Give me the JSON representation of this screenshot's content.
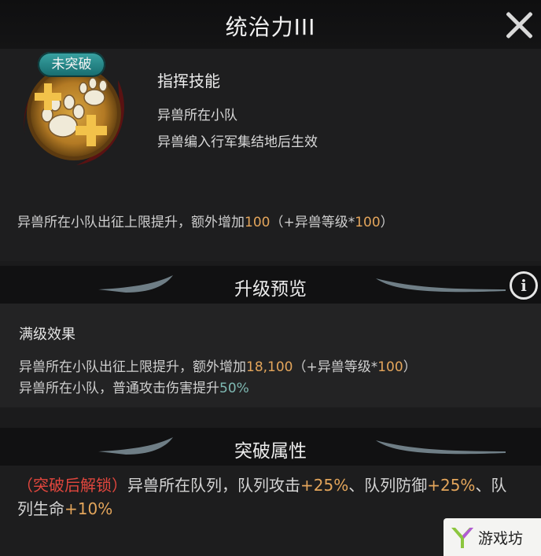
{
  "header": {
    "title": "统治力III"
  },
  "skill": {
    "badge": "未突破",
    "type": "指挥技能",
    "line1": "异兽所在小队",
    "line2": "异兽编入行军集结地后生效"
  },
  "effect": {
    "prefix": "异兽所在小队出征上限提升，额外增加",
    "value": "100",
    "suffix_open": "（+异兽等级*",
    "suffix_value": "100",
    "suffix_close": "）"
  },
  "upgrade": {
    "title": "升级预览",
    "info_label": "i",
    "max_label": "满级效果",
    "line1_prefix": "异兽所在小队出征上限提升，额外增加",
    "line1_value": "18,100",
    "line1_suffix_open": "（+异兽等级*",
    "line1_suffix_value": "100",
    "line1_suffix_close": "）",
    "line2_prefix": "异兽所在小队，普通攻击伤害提升",
    "line2_value": "50%"
  },
  "breakthrough": {
    "title": "突破属性",
    "lock_label": "（突破后解锁）",
    "text1": "异兽所在队列，队列攻击",
    "v1": "+25%",
    "text2": "、队列防御",
    "v2": "+25%",
    "text3": "、队列生命",
    "v3": "+10%"
  },
  "watermark": {
    "text": "游戏坊"
  },
  "colors": {
    "accent_orange": "#e3a55b",
    "accent_teal": "#7fb9b3",
    "lock_red": "#e0463d"
  }
}
